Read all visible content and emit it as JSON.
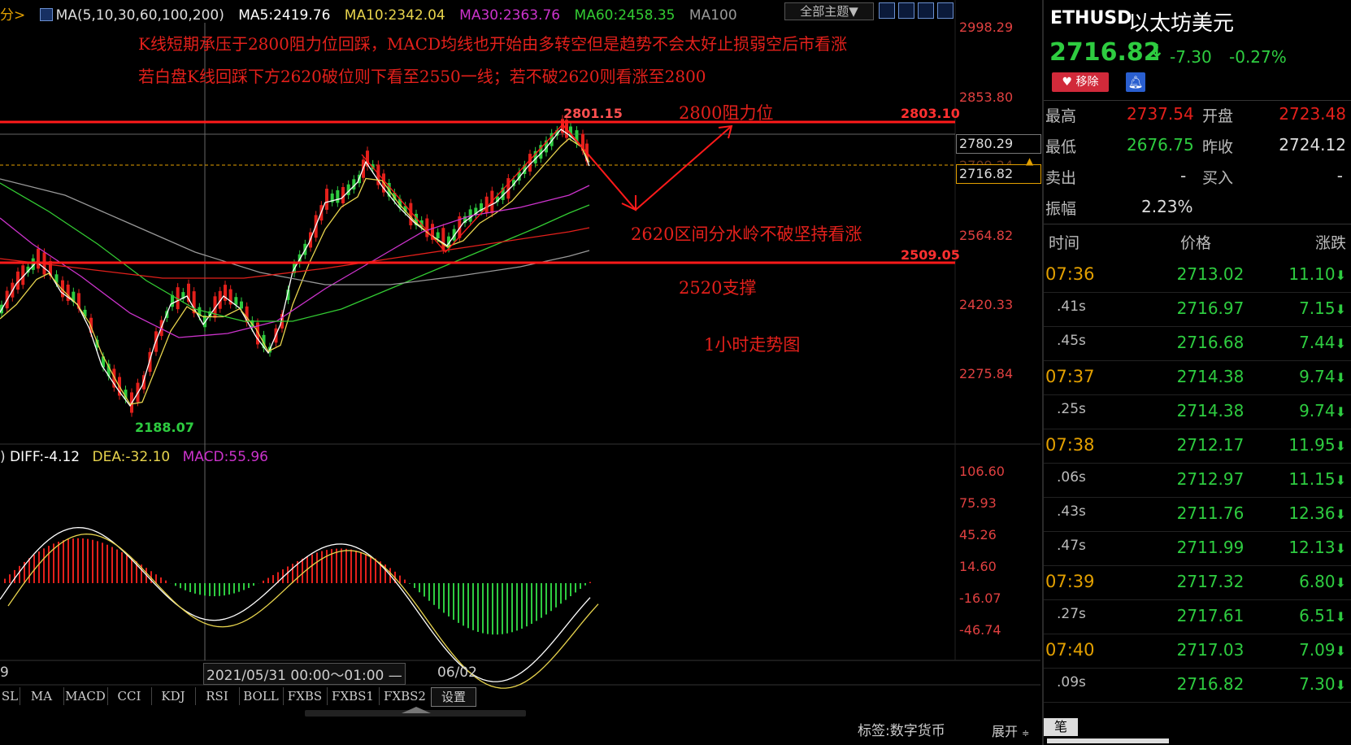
{
  "header": {
    "period_label": "分>",
    "ma_params": "MA(5,10,30,60,100,200)",
    "ma5": "MA5:2419.76",
    "ma10": "MA10:2342.04",
    "ma30": "MA30:2363.76",
    "ma60": "MA60:2458.35",
    "ma100": "MA100",
    "theme_button": "全部主题▼"
  },
  "annotations": {
    "line1": "K线短期承压于2800阻力位回踩，MACD均线也开始由多转空但是趋势不会太好止损弱空后市看涨",
    "line2": "若白盘K线回踩下方2620破位则下看至2550一线；若不破2620则看涨至2800",
    "resistance": "2800阻力位",
    "pivot": "2620区间分水岭不破坚持看涨",
    "support": "2520支撑",
    "timeframe": "1小时走势图",
    "high_mark": "2801.15",
    "low_mark": "2188.07",
    "resistance_line_label": "2803.10",
    "support_line_label": "2509.05"
  },
  "price_axis": {
    "ticks": [
      "2998.29",
      "2853.80",
      "2780.29",
      "2716.82",
      "2564.82",
      "2420.33",
      "2275.84"
    ],
    "hidden_tick": "2709.24"
  },
  "macd": {
    "params_prefix": ")",
    "diff": "DIFF:-4.12",
    "dea": "DEA:-32.10",
    "macd": "MACD:55.96",
    "ticks": [
      "106.60",
      "75.93",
      "45.26",
      "14.60",
      "-16.07",
      "-46.74"
    ]
  },
  "time_axis": {
    "left_label": "9",
    "cursor_label": "2021/05/31 00:00～01:00 —",
    "date_label": "06/02"
  },
  "indicator_tabs": [
    "SL",
    "MA",
    "MACD",
    "CCI",
    "KDJ",
    "RSI",
    "BOLL",
    "FXBS",
    "FXBS1",
    "FXBS2",
    "设置"
  ],
  "footer": {
    "tag": "标签:数字货币",
    "expand": "展开",
    "tab_bi": "笔"
  },
  "quote": {
    "symbol": "ETHUSD",
    "name": "以太坊美元",
    "price": "2716.82",
    "change": "-7.30",
    "change_pct": "-0.27%",
    "remove_btn": "移除",
    "high_label": "最高",
    "high": "2737.54",
    "open_label": "开盘",
    "open": "2723.48",
    "low_label": "最低",
    "low": "2676.75",
    "prev_label": "昨收",
    "prev": "2724.12",
    "sell_label": "卖出",
    "sell": "-",
    "buy_label": "买入",
    "buy": "-",
    "amp_label": "振幅",
    "amp": "2.23%",
    "col_time": "时间",
    "col_price": "价格",
    "col_change": "涨跌"
  },
  "ticks": [
    {
      "time": "07:36",
      "price": "2713.02",
      "chg": "11.10"
    },
    {
      "time": ".41s",
      "price": "2716.97",
      "chg": "7.15"
    },
    {
      "time": ".45s",
      "price": "2716.68",
      "chg": "7.44"
    },
    {
      "time": "07:37",
      "price": "2714.38",
      "chg": "9.74"
    },
    {
      "time": ".25s",
      "price": "2714.38",
      "chg": "9.74"
    },
    {
      "time": "07:38",
      "price": "2712.17",
      "chg": "11.95"
    },
    {
      "time": ".06s",
      "price": "2712.97",
      "chg": "11.15"
    },
    {
      "time": ".43s",
      "price": "2711.76",
      "chg": "12.36"
    },
    {
      "time": ".47s",
      "price": "2711.99",
      "chg": "12.13"
    },
    {
      "time": "07:39",
      "price": "2717.32",
      "chg": "6.80"
    },
    {
      "time": ".27s",
      "price": "2717.61",
      "chg": "6.51"
    },
    {
      "time": "07:40",
      "price": "2717.03",
      "chg": "7.09"
    },
    {
      "time": ".09s",
      "price": "2716.82",
      "chg": "7.30"
    }
  ],
  "colors": {
    "up": "#e3201b",
    "down": "#2ecc40",
    "ma5": "#ffffff",
    "ma10": "#e8d44d",
    "ma30": "#cc33cc",
    "ma60": "#33cc33",
    "ma100": "#999999"
  }
}
